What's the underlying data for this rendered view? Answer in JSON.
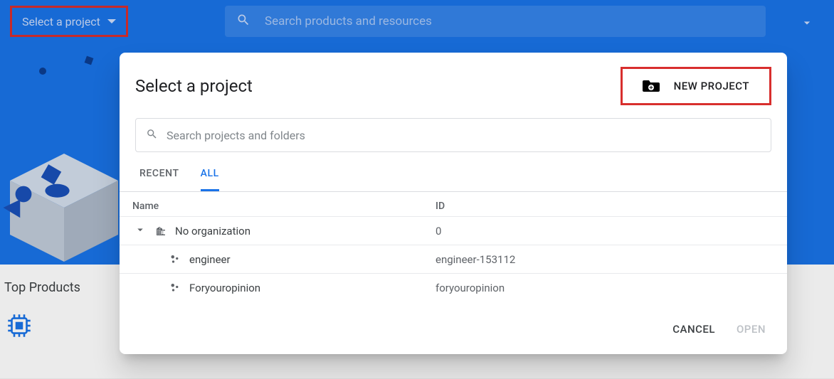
{
  "header": {
    "project_selector_label": "Select a project",
    "search_placeholder": "Search products and resources"
  },
  "left_section": {
    "heading": "Top Products"
  },
  "dialog": {
    "title": "Select a project",
    "new_project_label": "NEW PROJECT",
    "search_placeholder": "Search projects and folders",
    "tabs": [
      {
        "label": "RECENT",
        "active": false
      },
      {
        "label": "ALL",
        "active": true
      }
    ],
    "columns": {
      "name": "Name",
      "id": "ID"
    },
    "rows": [
      {
        "kind": "org",
        "name": "No organization",
        "id": "0",
        "indent": 1
      },
      {
        "kind": "project",
        "name": "engineer",
        "id": "engineer-153112",
        "indent": 2
      },
      {
        "kind": "project",
        "name": "Foryouropinion",
        "id": "foryouropinion",
        "indent": 2
      }
    ],
    "actions": {
      "cancel": "CANCEL",
      "open": "OPEN"
    }
  }
}
